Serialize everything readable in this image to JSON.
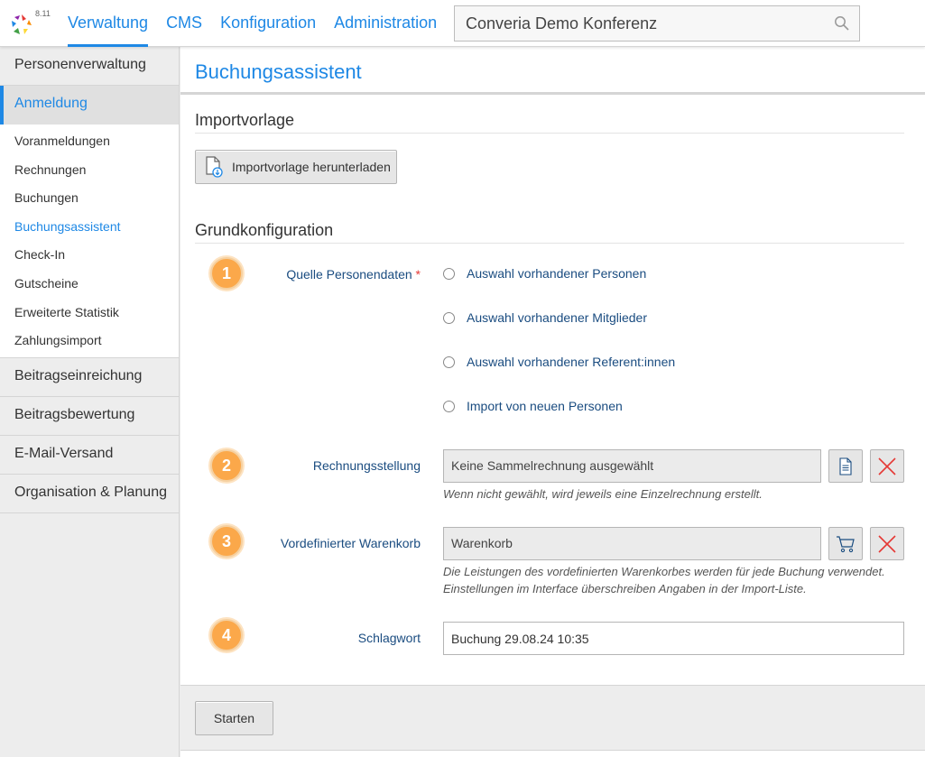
{
  "app": {
    "version": "8.11",
    "nav": [
      "Verwaltung",
      "CMS",
      "Konfiguration",
      "Administration"
    ],
    "active_nav": "Verwaltung",
    "search_value": "Converia Demo Konferenz",
    "brand_color": "#1e88e5"
  },
  "sidebar": {
    "sections_top": [
      {
        "label": "Personenverwaltung"
      }
    ],
    "active_section": "Anmeldung",
    "sub_items": [
      {
        "label": "Voranmeldungen"
      },
      {
        "label": "Rechnungen"
      },
      {
        "label": "Buchungen"
      },
      {
        "label": "Buchungsassistent",
        "active": true
      },
      {
        "label": "Check-In"
      },
      {
        "label": "Gutscheine"
      },
      {
        "label": "Erweiterte Statistik"
      },
      {
        "label": "Zahlungsimport"
      }
    ],
    "sections_bottom": [
      {
        "label": "Beitragseinreichung"
      },
      {
        "label": "Beitragsbewertung"
      },
      {
        "label": "E-Mail-Versand"
      },
      {
        "label": "Organisation & Planung"
      }
    ]
  },
  "page": {
    "title": "Buchungsassistent",
    "import_section": "Importvorlage",
    "download_button": "Importvorlage herunterladen",
    "config_section": "Grundkonfiguration",
    "steps": [
      "1",
      "2",
      "3",
      "4"
    ],
    "source": {
      "label": "Quelle Personendaten",
      "required_mark": "*",
      "options": [
        "Auswahl vorhandener Personen",
        "Auswahl vorhandener Mitglieder",
        "Auswahl vorhandener Referent:innen",
        "Import von neuen Personen"
      ]
    },
    "invoice": {
      "label": "Rechnungsstellung",
      "value": "Keine Sammelrechnung ausgewählt",
      "hint": "Wenn nicht gewählt, wird jeweils eine Einzelrechnung erstellt."
    },
    "cart": {
      "label": "Vordefinierter Warenkorb",
      "value": "Warenkorb",
      "hint_line1": "Die Leistungen des vordefinierten Warenkorbes werden für jede Buchung verwendet.",
      "hint_line2": "Einstellungen im Interface überschreiben Angaben in der Import-Liste."
    },
    "keyword": {
      "label": "Schlagwort",
      "value": "Buchung 29.08.24 10:35"
    },
    "start_button": "Starten"
  }
}
